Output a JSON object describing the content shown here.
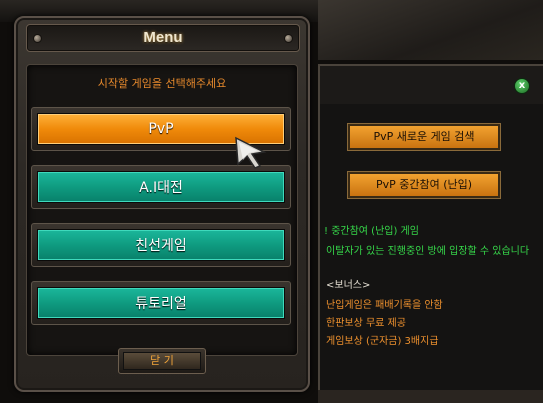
{
  "menu": {
    "title": "Menu",
    "subtitle": "시작할 게임을 선택해주세요",
    "buttons": [
      {
        "label": "PvP",
        "style": "orange"
      },
      {
        "label": "A.I대전",
        "style": "teal"
      },
      {
        "label": "친선게임",
        "style": "teal"
      },
      {
        "label": "튜토리얼",
        "style": "teal"
      }
    ],
    "close_label": "닫 기"
  },
  "info_panel": {
    "close_icon": "x-icon",
    "search_button": "PvP 새로운 게임 검색",
    "join_button": "PvP 중간참여 (난입)",
    "heading": "! 중간참여 (난입) 게임",
    "description": "이탈자가 있는 진행중인 방에 입장할 수 있습니다",
    "bonus_heading": "<보너스>",
    "bonus_items": [
      "난입게임은 패배기록을 안함",
      "한판보상 무료 제공",
      "게임보상 (군자금) 3배지급"
    ]
  },
  "colors": {
    "accent_orange": "#f08a0a",
    "accent_teal": "#0f9b80",
    "title_text": "#efe6cf",
    "info_green": "#36d84a"
  }
}
